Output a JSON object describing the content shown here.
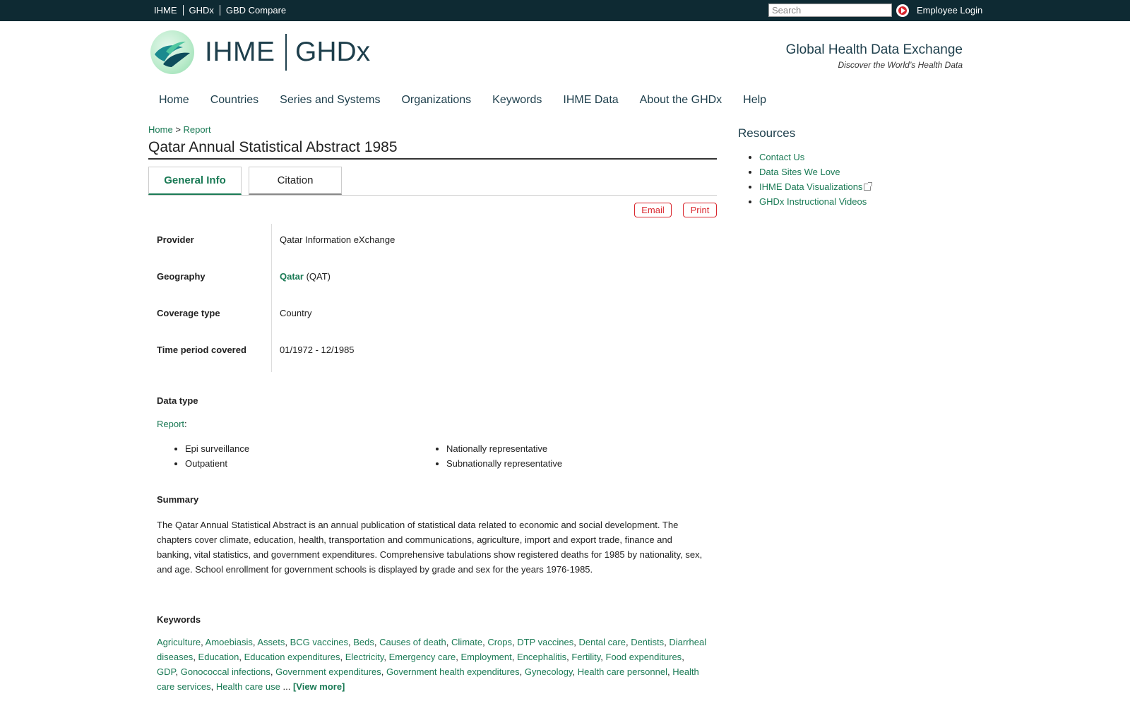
{
  "topbar": {
    "links": [
      "IHME",
      "GHDx",
      "GBD Compare"
    ],
    "search_placeholder": "Search",
    "employee_login": "Employee Login"
  },
  "header": {
    "logo_left": "IHME",
    "logo_right": "GHDx",
    "tagline": "Global Health Data Exchange",
    "tagline_sub": "Discover the World’s Health Data"
  },
  "nav": [
    "Home",
    "Countries",
    "Series and Systems",
    "Organizations",
    "Keywords",
    "IHME Data",
    "About the GHDx",
    "Help"
  ],
  "breadcrumb": {
    "home": "Home",
    "sep": ">",
    "current": "Report"
  },
  "page_title": "Qatar Annual Statistical Abstract 1985",
  "tabs": {
    "general": "General Info",
    "citation": "Citation"
  },
  "actions": {
    "email": "Email",
    "print": "Print"
  },
  "info": {
    "provider_label": "Provider",
    "provider_value": "Qatar Information eXchange",
    "geography_label": "Geography",
    "geography_link": "Qatar",
    "geography_code": "(QAT)",
    "coverage_label": "Coverage type",
    "coverage_value": "Country",
    "time_label": "Time period covered",
    "time_value": "01/1972 - 12/1985"
  },
  "data_type": {
    "label": "Data type",
    "report_link": "Report",
    "colon": ":",
    "col1": [
      "Epi surveillance",
      "Outpatient"
    ],
    "col2": [
      "Nationally representative",
      "Subnationally representative"
    ]
  },
  "summary": {
    "label": "Summary",
    "text": "The Qatar Annual Statistical Abstract is an annual publication of statistical data related to economic and social development. The chapters cover climate, education, health, transportation and communications, agriculture, import and export trade, finance and banking, vital statistics, and government expenditures. Comprehensive tabulations show registered deaths for 1985 by nationality, sex, and age. School enrollment for government schools is displayed by grade and sex for the years 1976-1985."
  },
  "keywords": {
    "label": "Keywords",
    "items": [
      "Agriculture",
      "Amoebiasis",
      "Assets",
      "BCG vaccines",
      "Beds",
      "Causes of death",
      "Climate",
      "Crops",
      "DTP vaccines",
      "Dental care",
      "Dentists",
      "Diarrheal diseases",
      "Education",
      "Education expenditures",
      "Electricity",
      "Emergency care",
      "Employment",
      "Encephalitis",
      "Fertility",
      "Food expenditures",
      "GDP",
      "Gonococcal infections",
      "Government expenditures",
      "Government health expenditures",
      "Gynecology",
      "Health care personnel",
      "Health care services",
      "Health care use"
    ],
    "ellipsis": "...",
    "view_more": "[View more]"
  },
  "sidebar": {
    "title": "Resources",
    "links": [
      "Contact Us",
      "Data Sites We Love",
      "IHME Data Visualizations",
      "GHDx Instructional Videos"
    ]
  },
  "colors": {
    "brand_dark": "#0e2a33",
    "link_green": "#1a7a55",
    "accent_red": "#d9272e"
  }
}
